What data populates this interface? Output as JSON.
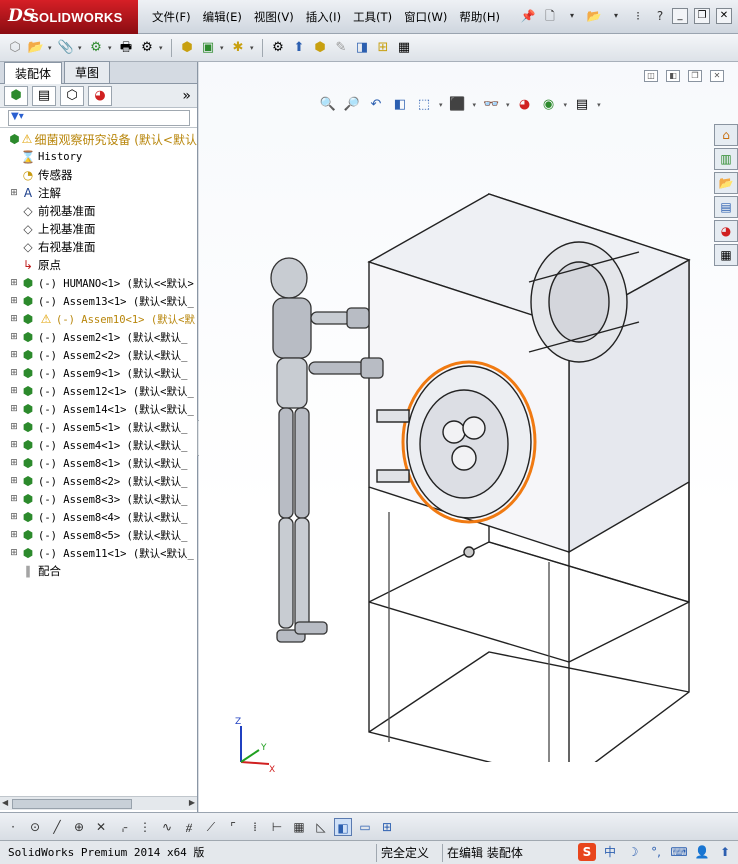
{
  "app": {
    "brand_prefix": "DS",
    "brand_name": "SOLIDWORKS"
  },
  "menu": [
    {
      "label": "文件(F)"
    },
    {
      "label": "编辑(E)"
    },
    {
      "label": "视图(V)"
    },
    {
      "label": "插入(I)"
    },
    {
      "label": "工具(T)"
    },
    {
      "label": "窗口(W)"
    },
    {
      "label": "帮助(H)"
    }
  ],
  "panel_tabs": [
    {
      "label": "装配体",
      "active": true
    },
    {
      "label": "草图",
      "active": false
    }
  ],
  "tree": [
    {
      "label": "细菌观察研究设备  (默认<默认",
      "level": 0,
      "icon": "assembly-warning-icon",
      "expand": ""
    },
    {
      "label": "History",
      "level": 1,
      "icon": "history-icon",
      "expand": "",
      "mono": true
    },
    {
      "label": "传感器",
      "level": 1,
      "icon": "sensor-icon",
      "expand": ""
    },
    {
      "label": "注解",
      "level": 1,
      "icon": "annotation-icon",
      "expand": "+"
    },
    {
      "label": "前视基准面",
      "level": 1,
      "icon": "plane-icon",
      "expand": ""
    },
    {
      "label": "上视基准面",
      "level": 1,
      "icon": "plane-icon",
      "expand": ""
    },
    {
      "label": "右视基准面",
      "level": 1,
      "icon": "plane-icon",
      "expand": ""
    },
    {
      "label": "原点",
      "level": 1,
      "icon": "origin-icon",
      "expand": ""
    },
    {
      "label": "(-) HUMANO<1> (默认<<默认>",
      "level": 1,
      "icon": "subassembly-icon",
      "expand": "+",
      "mono": true
    },
    {
      "label": "(-) Assem13<1> (默认<默认_",
      "level": 1,
      "icon": "subassembly-icon",
      "expand": "+",
      "mono": true
    },
    {
      "label": "(-) Assem10<1> (默认<默",
      "level": 1,
      "icon": "subassembly-icon",
      "expand": "+",
      "mono": true,
      "warning": true
    },
    {
      "label": "(-) Assem2<1> (默认<默认_",
      "level": 1,
      "icon": "subassembly-icon",
      "expand": "+",
      "mono": true
    },
    {
      "label": "(-) Assem2<2> (默认<默认_",
      "level": 1,
      "icon": "subassembly-icon",
      "expand": "+",
      "mono": true
    },
    {
      "label": "(-) Assem9<1> (默认<默认_",
      "level": 1,
      "icon": "subassembly-icon",
      "expand": "+",
      "mono": true
    },
    {
      "label": "(-) Assem12<1> (默认<默认_",
      "level": 1,
      "icon": "subassembly-icon",
      "expand": "+",
      "mono": true
    },
    {
      "label": "(-) Assem14<1> (默认<默认_",
      "level": 1,
      "icon": "subassembly-icon",
      "expand": "+",
      "mono": true
    },
    {
      "label": "(-) Assem5<1> (默认<默认_",
      "level": 1,
      "icon": "subassembly-icon",
      "expand": "+",
      "mono": true
    },
    {
      "label": "(-) Assem4<1> (默认<默认_",
      "level": 1,
      "icon": "subassembly-icon",
      "expand": "+",
      "mono": true
    },
    {
      "label": "(-) Assem8<1> (默认<默认_",
      "level": 1,
      "icon": "subassembly-icon",
      "expand": "+",
      "mono": true
    },
    {
      "label": "(-) Assem8<2> (默认<默认_",
      "level": 1,
      "icon": "subassembly-icon",
      "expand": "+",
      "mono": true
    },
    {
      "label": "(-) Assem8<3> (默认<默认_",
      "level": 1,
      "icon": "subassembly-icon",
      "expand": "+",
      "mono": true
    },
    {
      "label": "(-) Assem8<4> (默认<默认_",
      "level": 1,
      "icon": "subassembly-icon",
      "expand": "+",
      "mono": true
    },
    {
      "label": "(-) Assem8<5> (默认<默认_",
      "level": 1,
      "icon": "subassembly-icon",
      "expand": "+",
      "mono": true
    },
    {
      "label": "(-) Assem11<1> (默认<默认_",
      "level": 1,
      "icon": "subassembly-icon",
      "expand": "+",
      "mono": true
    },
    {
      "label": "配合",
      "level": 1,
      "icon": "mates-icon",
      "expand": ""
    }
  ],
  "status": {
    "product": "SolidWorks Premium 2014 x64 版",
    "definition": "完全定义",
    "mode": "在编辑 装配体"
  },
  "ime": {
    "lang": "中"
  },
  "triad": {
    "x": "X",
    "y": "Y",
    "z": "Z"
  }
}
